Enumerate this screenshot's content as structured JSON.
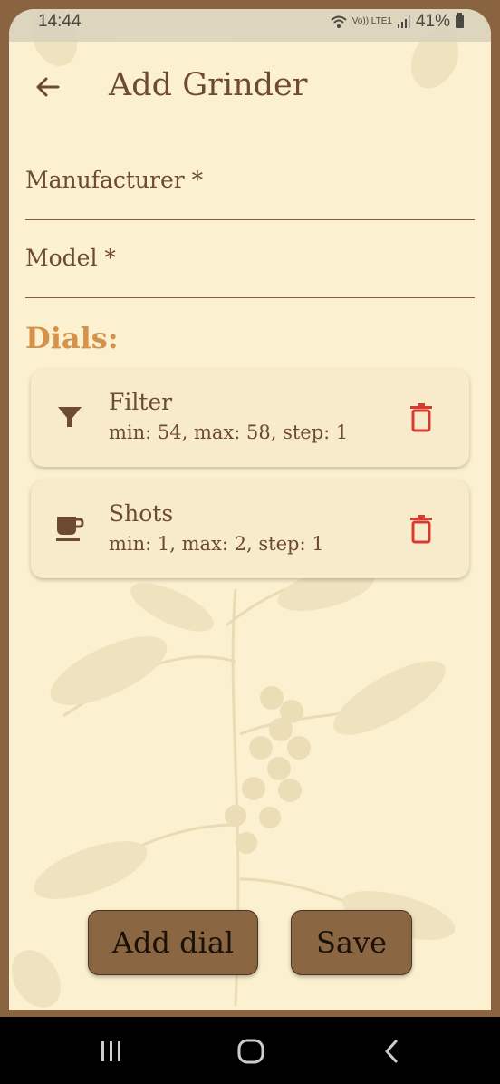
{
  "status_bar": {
    "time": "14:44",
    "network_label": "Vo)) LTE1",
    "battery": "41%"
  },
  "header": {
    "title": "Add Grinder",
    "back_icon": "arrow-left-icon"
  },
  "form": {
    "manufacturer_label": "Manufacturer *",
    "model_label": "Model *"
  },
  "dials_section": {
    "title": "Dials:",
    "items": [
      {
        "icon": "filter-funnel-icon",
        "name": "Filter",
        "meta": "min: 54, max: 58, step: 1"
      },
      {
        "icon": "coffee-cup-icon",
        "name": "Shots",
        "meta": "min: 1, max: 2, step: 1"
      }
    ]
  },
  "actions": {
    "add_dial_label": "Add dial",
    "save_label": "Save"
  },
  "colors": {
    "background": "#fbf0cf",
    "frame": "#8a6440",
    "text": "#6e4a33",
    "accent": "#d4924a",
    "delete": "#d63b2f",
    "button": "#8b6642"
  }
}
